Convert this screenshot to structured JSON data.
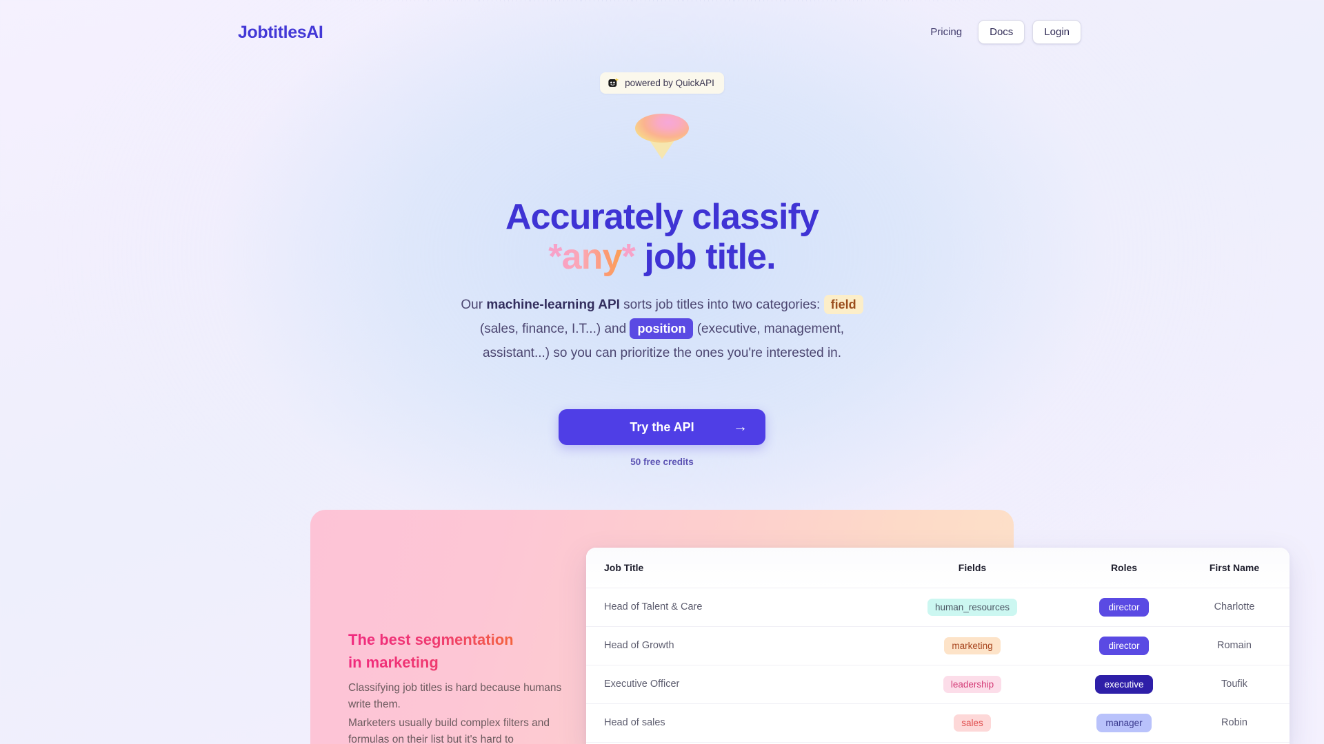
{
  "header": {
    "logo": "JobtitlesAI",
    "nav": [
      {
        "label": "Pricing",
        "type": "link",
        "name": "nav-pricing"
      },
      {
        "label": "Docs",
        "type": "button",
        "name": "nav-docs"
      },
      {
        "label": "Login",
        "type": "button",
        "name": "nav-login"
      }
    ]
  },
  "hero": {
    "badge": {
      "text": "powered by QuickAPI",
      "icon": "robot-icon"
    },
    "graphic": "funnel-graphic",
    "headline": {
      "line1": "Accurately classify",
      "asterisk_open": "*",
      "any": "any",
      "asterisk_close": "*",
      "line2_rest": " job title."
    },
    "subtitle": {
      "seg1": "Our ",
      "strong": "machine-learning API",
      "seg2": " sorts job titles into two categories: ",
      "pill_field": "field",
      "seg3": " (sales, finance, I.T...) and ",
      "pill_position": "position",
      "seg4": " (executive, management, assistant...) so you can prioritize the ones you're interested in."
    },
    "cta": {
      "label": "Try the API",
      "arrow": "→"
    },
    "credits": "50 free credits"
  },
  "segmentation": {
    "heading_line1": "The best segmentation",
    "heading_line2": "in marketing",
    "paragraph1": "Classifying job titles is hard because humans write them.",
    "paragraph2": "Marketers usually build complex filters and formulas on their list but it's hard to"
  },
  "table": {
    "columns": [
      "Job Title",
      "Fields",
      "Roles",
      "First Name"
    ],
    "rows": [
      {
        "job_title": "Head of Talent & Care",
        "field": "human_resources",
        "field_bg": "#ccf7f1",
        "field_color": "#4b5563",
        "role": "director",
        "role_bg": "#5a4ae3",
        "role_color": "#ffffff",
        "first_name": "Charlotte"
      },
      {
        "job_title": "Head of Growth",
        "field": "marketing",
        "field_bg": "#fde3c8",
        "field_color": "#a8461f",
        "role": "director",
        "role_bg": "#5a4ae3",
        "role_color": "#ffffff",
        "first_name": "Romain"
      },
      {
        "job_title": "Executive Officer",
        "field": "leadership",
        "field_bg": "#fcdde9",
        "field_color": "#d43b76",
        "role": "executive",
        "role_bg": "#2e1fa8",
        "role_color": "#ffffff",
        "first_name": "Toufik"
      },
      {
        "job_title": "Head of sales",
        "field": "sales",
        "field_bg": "#fdd8d8",
        "field_color": "#e05050",
        "role": "manager",
        "role_bg": "#b9c2fb",
        "role_color": "#3b3b8f",
        "first_name": "Robin"
      }
    ]
  },
  "colors": {
    "brand_indigo": "#4338d6",
    "cta_purple": "#4f3ee6",
    "accent_pink": "#f0297f",
    "accent_orange": "#f6762e"
  }
}
